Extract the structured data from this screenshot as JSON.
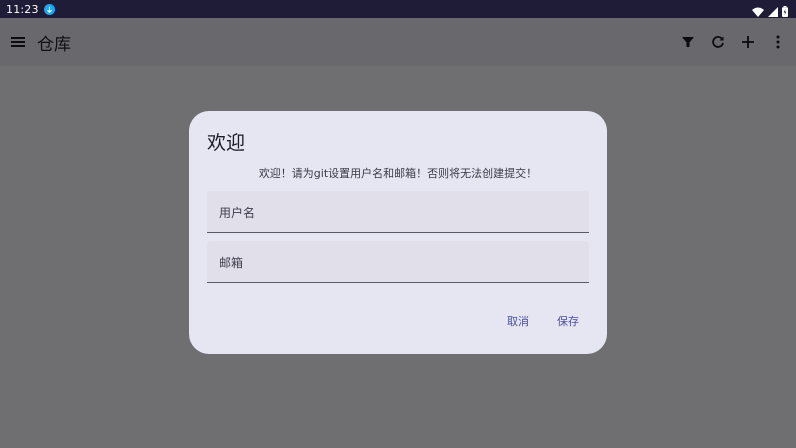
{
  "status_bar": {
    "time": "11:23"
  },
  "app_bar": {
    "title": "仓库",
    "actions": [
      "filter-icon",
      "refresh-icon",
      "add-icon",
      "more-vert-icon"
    ]
  },
  "dialog": {
    "title": "欢迎",
    "message": "欢迎！请为git设置用户名和邮箱！否则将无法创建提交！",
    "username_label": "用户名",
    "email_label": "邮箱",
    "cancel_label": "取消",
    "save_label": "保存"
  },
  "colors": {
    "status_bar": "#1f1c37",
    "app_bar": "#e9e8f1",
    "dialog_bg": "#e6e6f3",
    "accent": "#4a4fa0"
  }
}
